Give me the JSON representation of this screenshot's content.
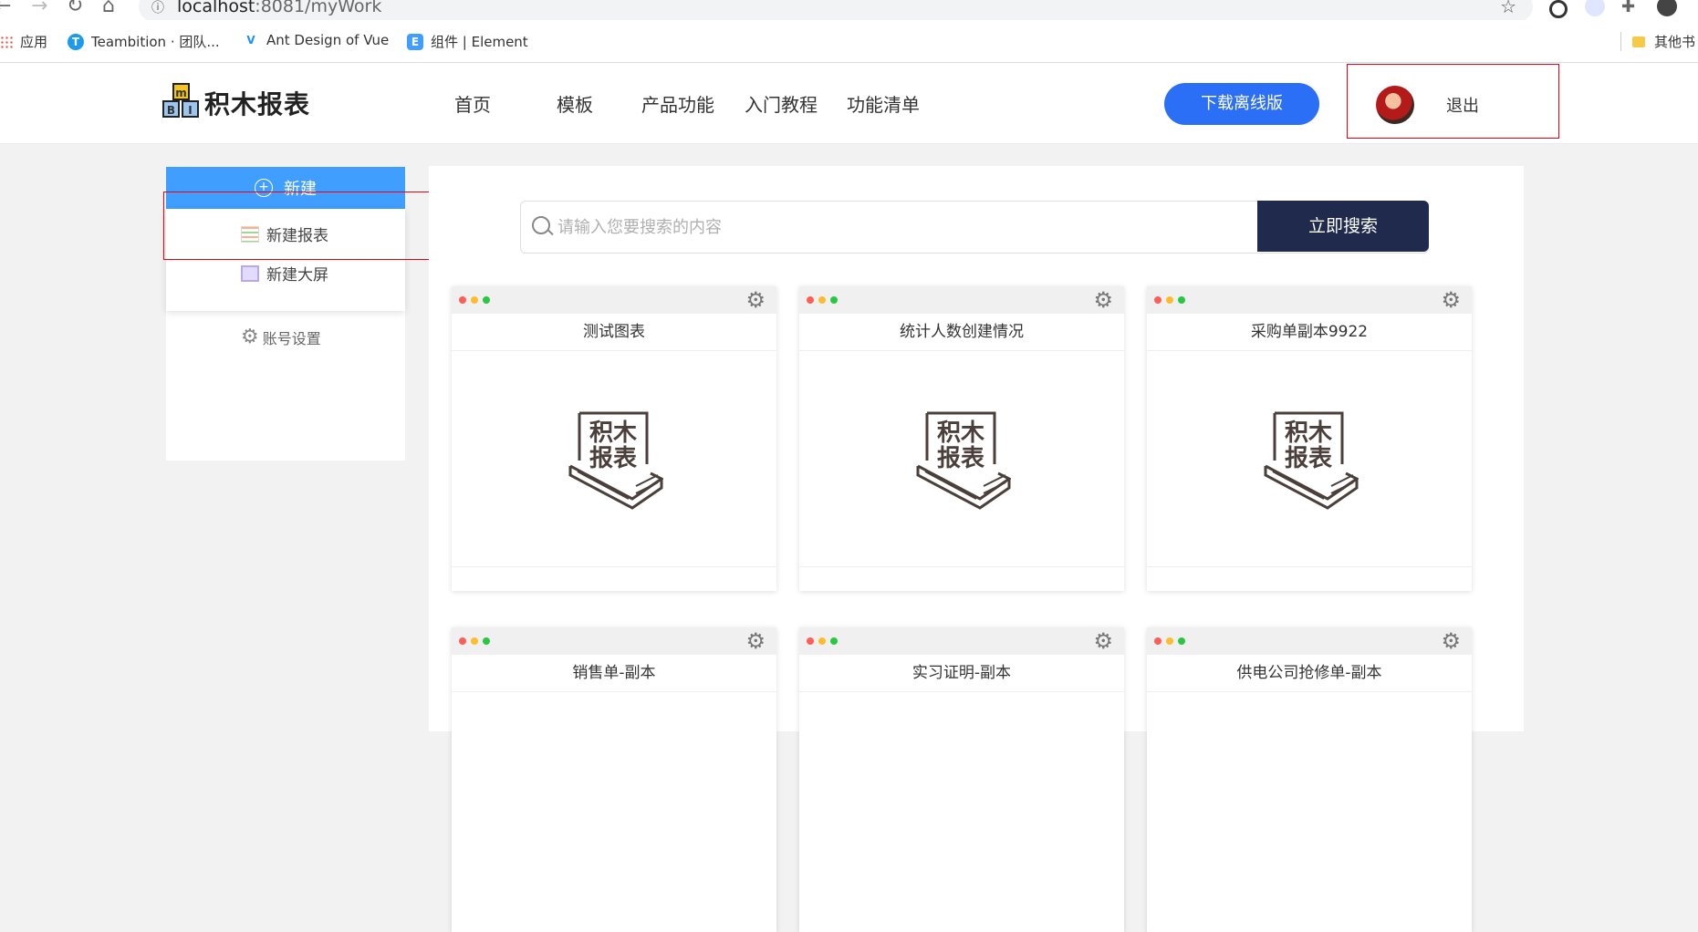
{
  "browser": {
    "url_host": "localhost",
    "url_path": ":8081/myWork",
    "info_glyph": "ⓘ",
    "bookmarks": [
      {
        "label": "应用"
      },
      {
        "label": "Teambition · 团队..."
      },
      {
        "label": "Ant Design of Vue"
      },
      {
        "label": "组件 | Element"
      }
    ],
    "other_bookmarks": "其他书"
  },
  "header": {
    "logo_text": "积木报表",
    "logo_letters": [
      "m",
      "B",
      "I"
    ],
    "nav": [
      "首页",
      "模板",
      "产品功能",
      "入门教程",
      "功能清单"
    ],
    "download_label": "下载离线版",
    "logout_label": "退出"
  },
  "sidebar": {
    "new_label": "新建",
    "new_report_label": "新建报表",
    "new_screen_label": "新建大屏",
    "account_label": "账号设置"
  },
  "search": {
    "placeholder": "请输入您要搜索的内容",
    "button_label": "立即搜索"
  },
  "cards": [
    {
      "title": "测试图表"
    },
    {
      "title": "统计人数创建情况"
    },
    {
      "title": "采购单副本9922"
    },
    {
      "title": "销售单-副本"
    },
    {
      "title": "实习证明-副本"
    },
    {
      "title": "供电公司抢修单-副本"
    }
  ],
  "colors": {
    "accent": "#409eff",
    "download": "#2b6ff6",
    "search_button": "#1f2a4d",
    "annotation": "#e60012"
  }
}
